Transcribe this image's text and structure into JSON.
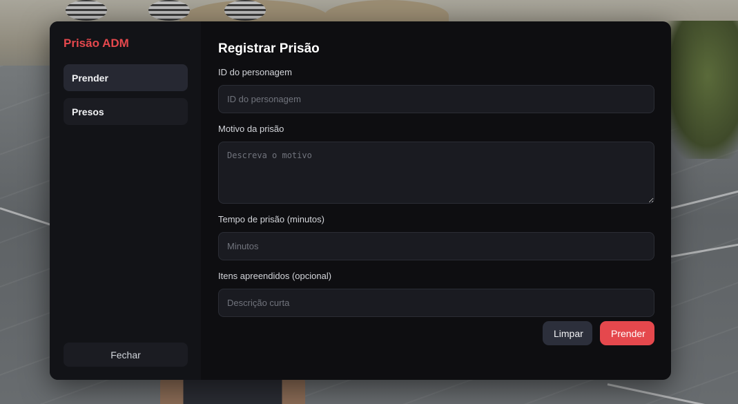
{
  "sidebar": {
    "brand": "Prisão ADM",
    "items": [
      {
        "label": "Prender",
        "active": true
      },
      {
        "label": "Presos",
        "active": false
      }
    ],
    "close_label": "Fechar"
  },
  "form": {
    "title": "Registrar Prisão",
    "character_id": {
      "label": "ID do personagem",
      "value": "",
      "placeholder": "ID do personagem"
    },
    "reason": {
      "label": "Motivo da prisão",
      "value": "",
      "placeholder": "Descreva o motivo"
    },
    "time": {
      "label": "Tempo de prisão (minutos)",
      "value": "",
      "placeholder": "Minutos"
    },
    "items": {
      "label": "Itens apreendidos (opcional)",
      "value": "",
      "placeholder": "Descrição curta"
    },
    "clear_label": "Limpar",
    "submit_label": "Prender"
  },
  "colors": {
    "accent": "#e5484d",
    "panel": "#0e0e11",
    "sidebar": "#121317"
  }
}
